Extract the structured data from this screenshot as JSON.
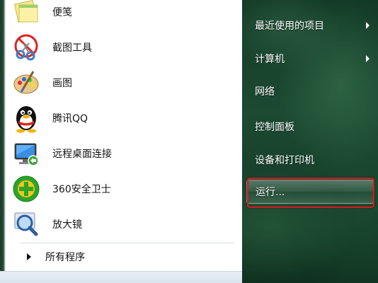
{
  "left_pane": {
    "programs": [
      {
        "label": "便笺",
        "icon": "sticky-notes-icon"
      },
      {
        "label": "截图工具",
        "icon": "snipping-tool-icon"
      },
      {
        "label": "画图",
        "icon": "paint-icon"
      },
      {
        "label": "腾讯QQ",
        "icon": "qq-penguin-icon"
      },
      {
        "label": "远程桌面连接",
        "icon": "remote-desktop-icon"
      },
      {
        "label": "360安全卫士",
        "icon": "360-security-icon"
      },
      {
        "label": "放大镜",
        "icon": "magnifier-icon"
      }
    ],
    "all_programs_label": "所有程序"
  },
  "right_pane": {
    "items": [
      {
        "label": "最近使用的项目",
        "has_submenu": true
      },
      {
        "label": "计算机",
        "has_submenu": true
      },
      {
        "label": "网络",
        "has_submenu": false
      },
      {
        "label": "控制面板",
        "has_submenu": false
      },
      {
        "label": "设备和打印机",
        "has_submenu": false
      },
      {
        "label": "运行...",
        "has_submenu": false,
        "highlighted": true
      }
    ]
  },
  "colors": {
    "highlight_border": "#e0141b",
    "right_pane_bg": "#1c4a33",
    "left_pane_bg": "#ffffff"
  }
}
